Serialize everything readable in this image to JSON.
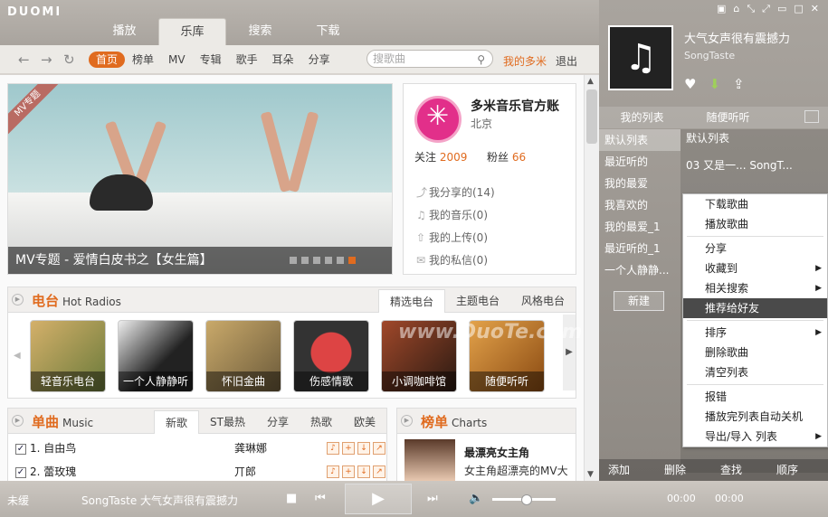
{
  "app": {
    "logo": "DUOMI"
  },
  "tabs": [
    "播放",
    "乐库",
    "搜索",
    "下载"
  ],
  "nav": {
    "items": [
      "首页",
      "榜单",
      "MV",
      "专辑",
      "歌手",
      "耳朵",
      "分享"
    ],
    "search_placeholder": "搜歌曲",
    "my": "我的多米",
    "logout": "退出"
  },
  "banner": {
    "corner": "MV专题",
    "caption": "MV专题 - 爱情白皮书之【女生篇】"
  },
  "profile": {
    "name": "多米音乐官方账",
    "city": "北京",
    "follow_label": "关注",
    "follow": "2009",
    "fans_label": "粉丝",
    "fans": "66",
    "links": [
      "我分享的(14)",
      "我的音乐(0)",
      "我的上传(0)",
      "我的私信(0)"
    ]
  },
  "radio": {
    "title": "电台",
    "subtitle": "Hot Radios",
    "tabs": [
      "精选电台",
      "主题电台",
      "风格电台"
    ],
    "stations": [
      "轻音乐电台",
      "一个人静静听",
      "怀旧金曲",
      "伤感情歌",
      "小调咖啡馆",
      "随便听听"
    ]
  },
  "music": {
    "title": "单曲",
    "subtitle": "Music",
    "tabs": [
      "新歌",
      "ST最热",
      "分享",
      "热歌",
      "欧美"
    ],
    "songs": [
      {
        "name": "1. 自由鸟",
        "singer": "龚琳娜"
      },
      {
        "name": "2. 蕾玫瑰",
        "singer": "丌郎"
      }
    ]
  },
  "charts": {
    "title": "榜单",
    "subtitle": "Charts",
    "headline": "最漂亮女主角",
    "desc": "女主角超漂亮的MV大"
  },
  "now": {
    "title": "大气女声很有震撼力",
    "artist": "SongTaste"
  },
  "right": {
    "tabs": [
      "我的列表",
      "随便听听"
    ],
    "playlists": [
      "默认列表",
      "最近听的",
      "我的最爱",
      "我喜欢的",
      "我的最爱_1",
      "最近听的_1",
      "一个人静静..."
    ],
    "track_head": "默认列表",
    "track": "03  又是一...  SongT...",
    "new": "新建",
    "footer": [
      "添加",
      "删除",
      "查找",
      "顺序"
    ]
  },
  "menu": [
    "下载歌曲",
    "播放歌曲",
    "分享",
    "收藏到",
    "相关搜索",
    "推荐给好友",
    "排序",
    "删除歌曲",
    "清空列表",
    "报错",
    "播放完列表自动关机",
    "导出/导入 列表"
  ],
  "player": {
    "label": "未缓",
    "track": "SongTaste 大气女声很有震撼力",
    "time1": "00:00",
    "time2": "00:00"
  },
  "watermark": "www.DuoTe.com"
}
